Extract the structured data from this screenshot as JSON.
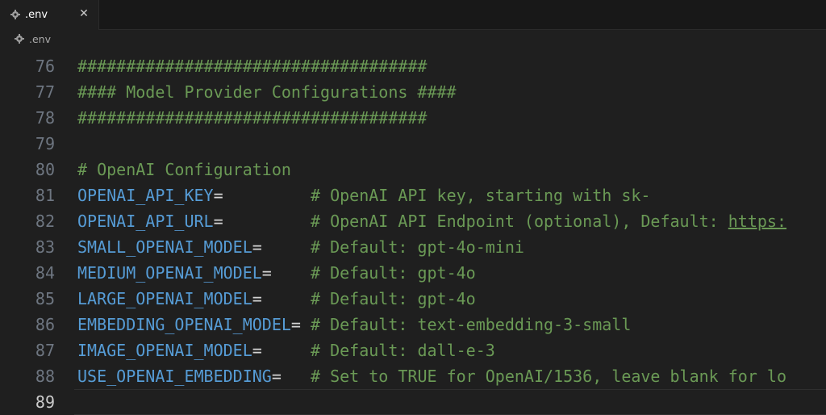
{
  "tab": {
    "label": ".env",
    "icon": "gear-icon",
    "close": "✕"
  },
  "breadcrumb": {
    "label": ".env",
    "icon": "gear-icon"
  },
  "lines": [
    {
      "num": "76",
      "text": "####################################"
    },
    {
      "num": "77",
      "text": "#### Model Provider Configurations ####"
    },
    {
      "num": "78",
      "text": "####################################"
    },
    {
      "num": "79",
      "text": ""
    },
    {
      "num": "80",
      "text": "# OpenAI Configuration"
    },
    {
      "num": "81",
      "key": "OPENAI_API_KEY",
      "eq": "=",
      "pad": "         ",
      "comment": "# OpenAI API key, starting with sk-"
    },
    {
      "num": "82",
      "key": "OPENAI_API_URL",
      "eq": "=",
      "pad": "         ",
      "comment": "# OpenAI API Endpoint (optional), Default: ",
      "link": "https:"
    },
    {
      "num": "83",
      "key": "SMALL_OPENAI_MODEL",
      "eq": "=",
      "pad": "     ",
      "comment": "# Default: gpt-4o-mini"
    },
    {
      "num": "84",
      "key": "MEDIUM_OPENAI_MODEL",
      "eq": "=",
      "pad": "    ",
      "comment": "# Default: gpt-4o"
    },
    {
      "num": "85",
      "key": "LARGE_OPENAI_MODEL",
      "eq": "=",
      "pad": "     ",
      "comment": "# Default: gpt-4o"
    },
    {
      "num": "86",
      "key": "EMBEDDING_OPENAI_MODEL",
      "eq": "=",
      "pad": " ",
      "comment": "# Default: text-embedding-3-small"
    },
    {
      "num": "87",
      "key": "IMAGE_OPENAI_MODEL",
      "eq": "=",
      "pad": "     ",
      "comment": "# Default: dall-e-3"
    },
    {
      "num": "88",
      "key": "USE_OPENAI_EMBEDDING",
      "eq": "=",
      "pad": "   ",
      "comment": "# Set to TRUE for OpenAI/1536, leave blank for lo"
    },
    {
      "num": "89",
      "text": "",
      "active": true
    }
  ],
  "colors": {
    "background": "#1f1f1f",
    "comment": "#6a9955",
    "key": "#569cd6",
    "line_number": "#6e7681"
  }
}
